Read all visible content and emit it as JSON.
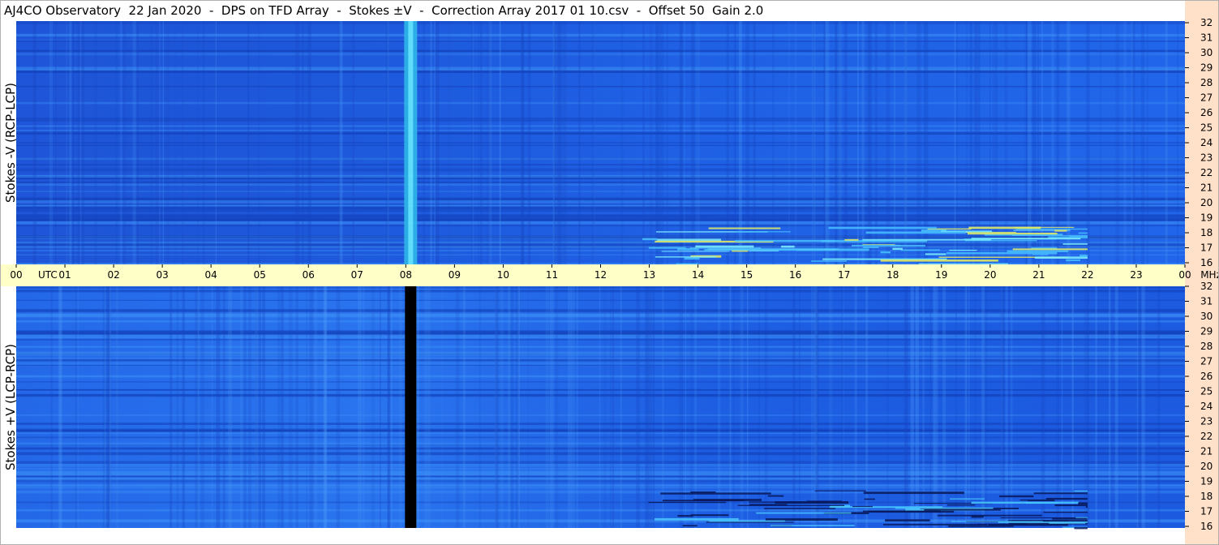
{
  "title": "AJ4CO Observatory  22 Jan 2020  -  DPS on TFD Array  -  Stokes ±V  -  Correction Array 2017 01 10.csv  -  Offset 50  Gain 2.0",
  "colors": {
    "background": "#1e5ee8",
    "time_axis_bar": "#ffffc8",
    "freq_axis_bar": "#ffe0c8",
    "bright": "#36d0ff",
    "dark": "#0a2a8a"
  },
  "time_axis": {
    "labels": [
      "00",
      "UTC",
      "01",
      "02",
      "03",
      "04",
      "05",
      "06",
      "07",
      "08",
      "09",
      "10",
      "11",
      "12",
      "13",
      "14",
      "15",
      "16",
      "17",
      "18",
      "19",
      "20",
      "21",
      "22",
      "23",
      "00",
      "MHz"
    ]
  },
  "chart_data": [
    {
      "type": "heatmap",
      "panel": "top",
      "ylabel": "Stokes -V (RCP-LCP)",
      "x_range_utc_hours": [
        0,
        24
      ],
      "y_range_mhz": [
        16,
        32
      ],
      "y_ticks": [
        32,
        31,
        30,
        29,
        28,
        27,
        26,
        25,
        24,
        23,
        22,
        21,
        20,
        19,
        18,
        17,
        16
      ],
      "features": [
        {
          "kind": "vertical band",
          "utc_hour": 8.1,
          "appearance": "bright cyan"
        },
        {
          "kind": "bursts",
          "utc_hour_range": [
            12.8,
            22.0
          ],
          "mhz_range": [
            16,
            18.5
          ],
          "appearance": "cyan/yellow streaks"
        }
      ]
    },
    {
      "type": "heatmap",
      "panel": "bottom",
      "ylabel": "Stokes +V (LCP-RCP)",
      "x_range_utc_hours": [
        0,
        24
      ],
      "y_range_mhz": [
        16,
        32
      ],
      "y_ticks": [
        32,
        31,
        30,
        29,
        28,
        27,
        26,
        25,
        24,
        23,
        22,
        21,
        20,
        19,
        18,
        17,
        16
      ],
      "features": [
        {
          "kind": "vertical band",
          "utc_hour": 8.1,
          "appearance": "black"
        },
        {
          "kind": "bursts",
          "utc_hour_range": [
            12.8,
            22.0
          ],
          "mhz_range": [
            16,
            18.5
          ],
          "appearance": "dark streaks"
        }
      ]
    }
  ]
}
